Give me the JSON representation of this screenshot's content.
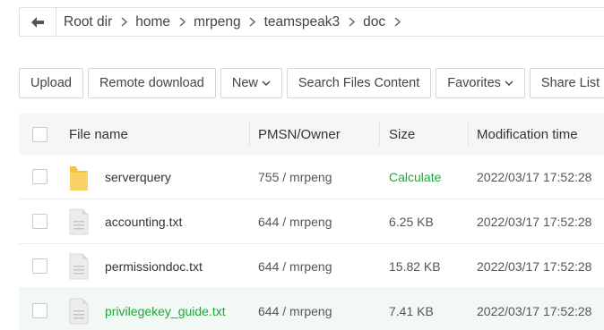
{
  "breadcrumb": {
    "items": [
      "Root dir",
      "home",
      "mrpeng",
      "teamspeak3",
      "doc"
    ]
  },
  "toolbar": {
    "upload": "Upload",
    "remote_download": "Remote download",
    "new": "New",
    "search": "Search Files Content",
    "favorites": "Favorites",
    "share_list": "Share List"
  },
  "table": {
    "headers": {
      "name": "File name",
      "pmsn": "PMSN/Owner",
      "size": "Size",
      "modified": "Modification time"
    },
    "rows": [
      {
        "name": "serverquery",
        "type": "folder-icon",
        "pmsn": "755 / mrpeng",
        "size": "Calculate",
        "modified": "2022/03/17 17:52:28"
      },
      {
        "name": "accounting.txt",
        "type": "file-icon",
        "pmsn": "644 / mrpeng",
        "size": "6.25 KB",
        "modified": "2022/03/17 17:52:28"
      },
      {
        "name": "permissiondoc.txt",
        "type": "file-icon",
        "pmsn": "644 / mrpeng",
        "size": "15.82 KB",
        "modified": "2022/03/17 17:52:28"
      },
      {
        "name": "privilegekey_guide.txt",
        "type": "file-icon",
        "pmsn": "644 / mrpeng",
        "size": "7.41 KB",
        "modified": "2022/03/17 17:52:28"
      }
    ]
  },
  "colors": {
    "accent": "#20a53a",
    "folder": "#f5c342",
    "header_bg": "#f6f6f6",
    "hover_row_bg": "#f2f9f5"
  }
}
